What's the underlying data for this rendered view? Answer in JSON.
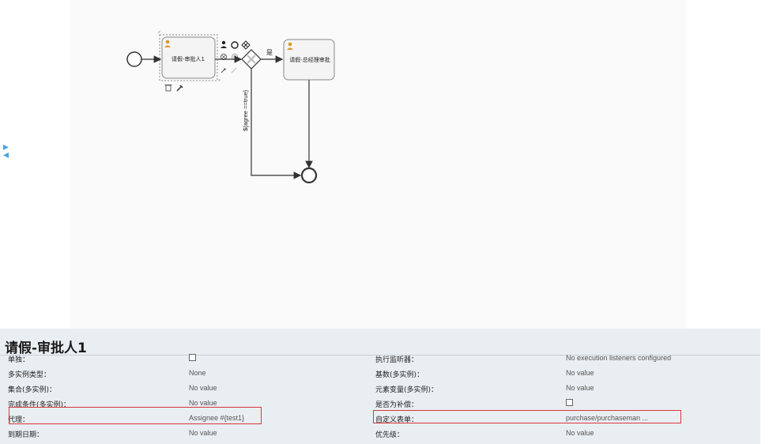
{
  "sidebar_toggles": [
    "expand-arrow-icon",
    "collapse-arrow-icon"
  ],
  "diagram": {
    "task1_label": "请假-审批人1",
    "task2_label": "请假-总经理审批",
    "flow_yes_label": "是",
    "flow_condition_label": "${agree ==true}"
  },
  "properties": {
    "title": "请假-审批人1",
    "rows": [
      {
        "l1": "单独：",
        "v1": "",
        "v1_checkbox": true,
        "l2": "执行监听器：",
        "v2": "No execution listeners configured"
      },
      {
        "l1": "多实例类型：",
        "v1": "None",
        "l2": "基数(多实例)：",
        "v2": "No value"
      },
      {
        "l1": "集合(多实例)：",
        "v1": "No value",
        "l2": "元素变量(多实例)：",
        "v2": "No value"
      },
      {
        "l1": "完成条件(多实例)：",
        "v1": "No value",
        "l2": "是否为补偿：",
        "v2": "",
        "v2_checkbox": true
      },
      {
        "l1": "代理：",
        "v1": "Assignee #{test1}",
        "l2": "自定义表单：",
        "v2": "purchase/purchaseman ..."
      },
      {
        "l1": "到期日期：",
        "v1": "No value",
        "l2": "优先级：",
        "v2": "No value"
      }
    ]
  },
  "colors": {
    "highlight": "#d9363e",
    "accent": "#4aa3e0",
    "panel": "#e9eef2"
  }
}
